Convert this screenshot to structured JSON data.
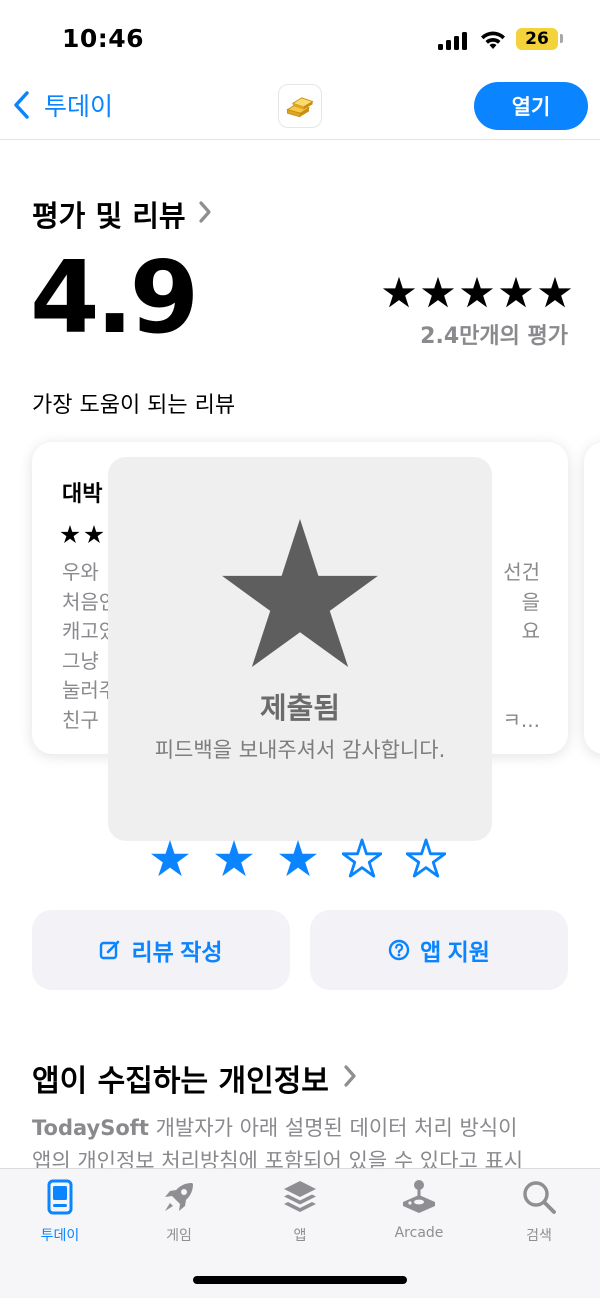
{
  "status_bar": {
    "time": "10:46",
    "battery": "26"
  },
  "nav": {
    "back_label": "투데이",
    "open_button": "열기"
  },
  "ratings": {
    "section_title": "평가 및 리뷰",
    "average": "4.9",
    "stars": 5,
    "count_label": "2.4만개의 평가",
    "helpful_heading": "가장 도움이 되는 리뷰"
  },
  "review": {
    "title": "대박",
    "stars": 2,
    "lines": [
      {
        "left": "우와",
        "right": "선건"
      },
      {
        "left": "처음인",
        "right": "을"
      },
      {
        "left": "캐고있",
        "right": "요"
      },
      {
        "left": "그냥",
        "right": ""
      },
      {
        "left": "눌러주",
        "right": ""
      },
      {
        "left": "친구",
        "right": "ㅋ..."
      }
    ]
  },
  "submitted": {
    "title": "제출됨",
    "message": "피드백을 보내주셔서 감사합니다."
  },
  "tap_to_rate": {
    "filled": 3,
    "total": 5
  },
  "actions": {
    "write_review": "리뷰 작성",
    "app_support": "앱 지원"
  },
  "privacy": {
    "title": "앱이 수집하는 개인정보",
    "developer": "TodaySoft",
    "text_line1": " 개발자가 아래 설명된 데이터 처리 방식이",
    "text_line2": "앱의 개인정보 처리방침에 포함되어 있을 수 있다고 표시"
  },
  "tab_bar": {
    "tabs": [
      {
        "label": "투데이",
        "icon": "today-icon",
        "active": true
      },
      {
        "label": "게임",
        "icon": "rocket-icon",
        "active": false
      },
      {
        "label": "앱",
        "icon": "apps-stack-icon",
        "active": false
      },
      {
        "label": "Arcade",
        "icon": "joystick-icon",
        "active": false
      },
      {
        "label": "검색",
        "icon": "search-icon",
        "active": false
      }
    ]
  },
  "colors": {
    "accent": "#0a84ff",
    "battery": "#f4d23a",
    "hud_background": "#efefef",
    "hud_star": "#5e5e5e",
    "secondary_text": "#8a8a8e"
  }
}
